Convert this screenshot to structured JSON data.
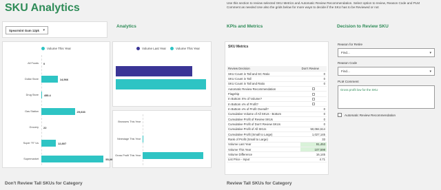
{
  "app": {
    "title": "SKU Analytics",
    "instructions": "Use this section to review selected SKU Metrics and Automatic Review Recommendation. Select option to review, Reason Code and PLM Comment as needed Use also the grids below for more ways to decide if the SKU has to be Reviewed or not"
  },
  "filter": {
    "product_value": "Spearmint Gum 12pk"
  },
  "sections": {
    "analytics": "Analytics",
    "kpis": "KPIs and Metrics",
    "decision": "Decision to Review SKU",
    "dont_review": "Don't Review Tall SKUs for Category",
    "review": "Review Tall SKUs for Category"
  },
  "colors": {
    "teal": "#2ec4c4",
    "purple": "#3a3596",
    "green": "#2e8b57"
  },
  "chart_left": {
    "type": "bar",
    "legend": "Volume This Year",
    "categories": [
      "All Foods",
      "Dollar Store",
      "Drug Store",
      "Gas Station",
      "Grocery",
      "Super \"R\" Us",
      "Supermarket"
    ],
    "values": [
      0,
      14566,
      455.4,
      29633,
      22,
      12807,
      55091
    ],
    "labels": [
      "0",
      "14,566",
      "455.4",
      "29,633",
      "22",
      "12,807",
      "55,091"
    ],
    "xlim": [
      0,
      58000
    ]
  },
  "chart_right_top": {
    "type": "bar",
    "legend": [
      "Volume Last Year",
      "Volume This Year"
    ],
    "series": [
      {
        "name": "Volume Last Year",
        "values": [
          91453
        ]
      },
      {
        "name": "Volume This Year",
        "values": [
          107598
        ]
      }
    ],
    "xlim": [
      0,
      110000
    ]
  },
  "chart_right_bottom": {
    "type": "bar",
    "categories": [
      "Browsers This Year",
      "Ninestage This Year",
      "Gross Profit This Year"
    ],
    "values": [
      0,
      33,
      4711
    ],
    "xlim": [
      0,
      4900
    ]
  },
  "metrics": {
    "title": "SKU Metrics",
    "col1": "Review Decision",
    "col2": "Don't Review",
    "rows": [
      {
        "label": "SKU Count in Tall and SC Ratio",
        "value": "0",
        "kind": "text"
      },
      {
        "label": "SKU Count in Tall",
        "value": "0",
        "kind": "text"
      },
      {
        "label": "SKU Count in Tall and Ratio",
        "value": "0",
        "kind": "text"
      },
      {
        "label": "Automatic Review Recommendation",
        "value": "",
        "kind": "check"
      },
      {
        "label": "Flagship",
        "value": "",
        "kind": "check"
      },
      {
        "label": "In Bottom X% of Volume?",
        "value": "",
        "kind": "check"
      },
      {
        "label": "In Bottom x% of Profit?",
        "value": "",
        "kind": "check"
      },
      {
        "label": "In Bottom x% of Profit Overall?",
        "value": "0",
        "kind": "text"
      },
      {
        "label": "Cumulative Volume of All SKUs - Bottom",
        "value": "0",
        "kind": "text"
      },
      {
        "label": "Cumulative Profit of Review SKUs",
        "value": "0",
        "kind": "text"
      },
      {
        "label": "Cumulative Profit of Don't Review SKUs",
        "value": "0",
        "kind": "text"
      },
      {
        "label": "Cumulative Profit of All SKUs",
        "value": "50,084,614",
        "kind": "text"
      },
      {
        "label": "Cumulative Profit (Small to Large)",
        "value": "1,027,145",
        "kind": "text"
      },
      {
        "label": "Rank of Profit (Small to Large)",
        "value": "33",
        "kind": "text"
      },
      {
        "label": "Volume Last Year",
        "value": "91,453",
        "kind": "hl"
      },
      {
        "label": "Volume This Year",
        "value": "107,598",
        "kind": "hl"
      },
      {
        "label": "Volume Difference",
        "value": "16,145",
        "kind": "text"
      },
      {
        "label": "List Price - Input",
        "value": "4.71",
        "kind": "text"
      }
    ]
  },
  "decision": {
    "reason_for_retire_label": "Reason for Retire",
    "reason_for_retire_value": "Find...",
    "reason_code_label": "Reason Code",
    "reason_code_value": "Find...",
    "plm_comment_label": "PLM Comment",
    "plm_comment_value": "Gross profit low for the SKU",
    "auto_review_label": "Automatic Review Recommendation"
  }
}
